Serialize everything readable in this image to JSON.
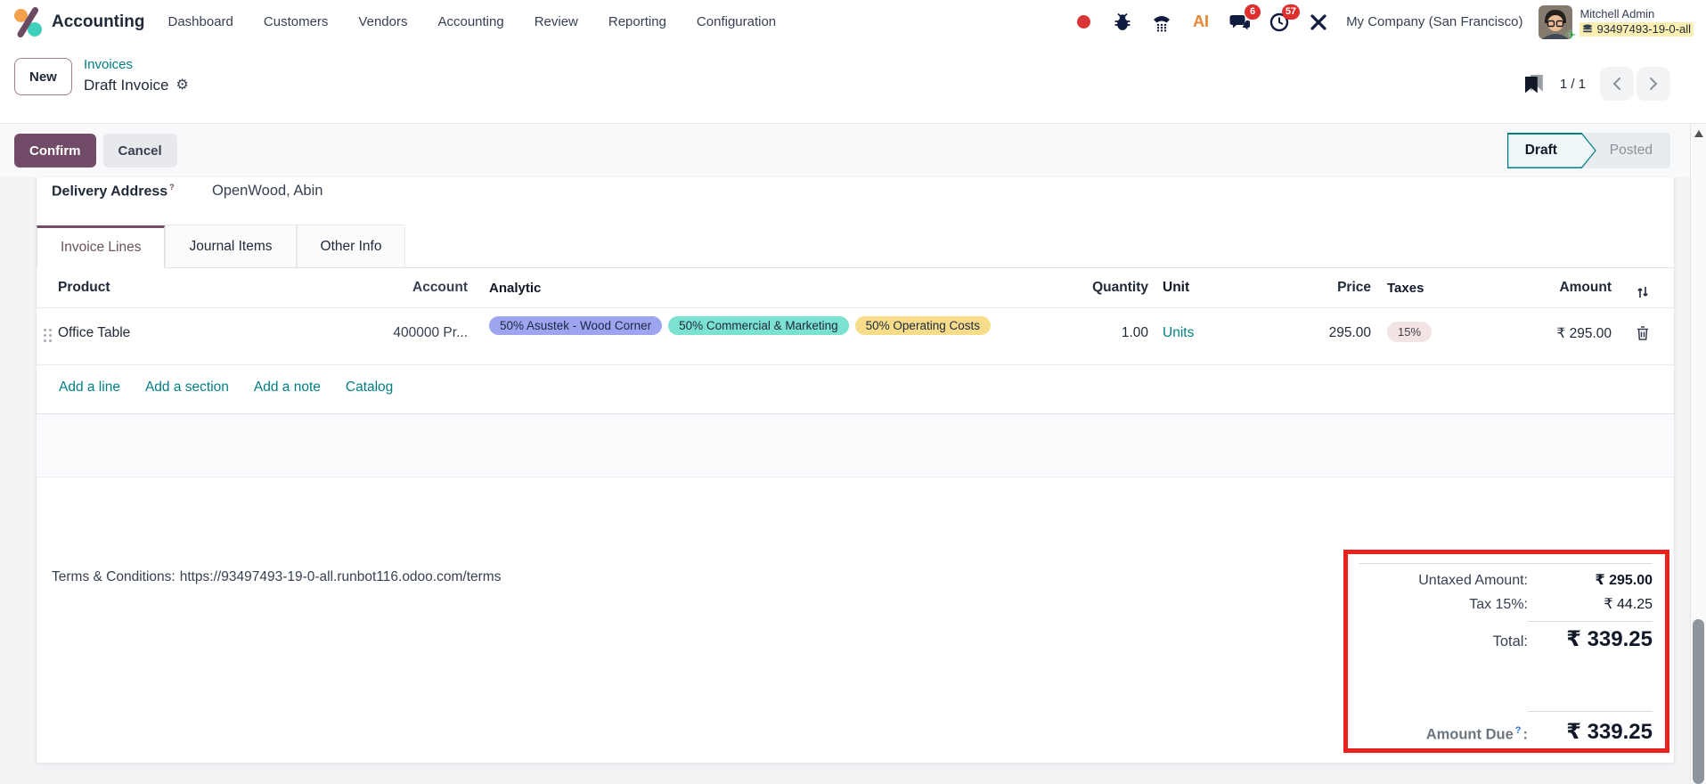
{
  "topnav": {
    "app_name": "Accounting",
    "menu": [
      "Dashboard",
      "Customers",
      "Vendors",
      "Accounting",
      "Review",
      "Reporting",
      "Configuration"
    ],
    "systray": {
      "ai_label": "AI",
      "chat_badge": "6",
      "activity_badge": "57",
      "company": "My Company (San Francisco)",
      "user_name": "Mitchell Admin",
      "database": "93497493-19-0-all"
    }
  },
  "control_panel": {
    "new_button": "New",
    "breadcrumb_parent": "Invoices",
    "breadcrumb_current": "Draft Invoice",
    "pager": "1 / 1"
  },
  "action_bar": {
    "confirm": "Confirm",
    "cancel": "Cancel",
    "status": [
      "Draft",
      "Posted"
    ],
    "active_status": "Draft"
  },
  "form": {
    "delivery_address_label": "Delivery Address",
    "delivery_sup": "?",
    "delivery_address_value": "OpenWood, Abin",
    "tabs": [
      "Invoice Lines",
      "Journal Items",
      "Other Info"
    ],
    "active_tab": "Invoice Lines"
  },
  "lines_table": {
    "headers": [
      "Product",
      "Account",
      "Analytic",
      "Quantity",
      "Unit",
      "Price",
      "Taxes",
      "Amount"
    ],
    "rows": [
      {
        "product": "Office Table",
        "account": "400000 Pr...",
        "analytic_tags": [
          {
            "label": "50% Asustek - Wood Corner",
            "color": "#9da5f0"
          },
          {
            "label": "50% Commercial & Marketing",
            "color": "#7be1d0"
          },
          {
            "label": "50% Operating Costs",
            "color": "#f7dd8a"
          }
        ],
        "quantity": "1.00",
        "unit": "Units",
        "price": "295.00",
        "tax": "15%",
        "amount": "₹ 295.00"
      }
    ],
    "footer_links": [
      "Add a line",
      "Add a section",
      "Add a note",
      "Catalog"
    ]
  },
  "footer": {
    "terms_label": "Terms & Conditions:",
    "terms_url": "https://93497493-19-0-all.runbot116.odoo.com/terms",
    "totals": {
      "untaxed_label": "Untaxed Amount:",
      "untaxed_value": "₹ 295.00",
      "tax_label": "Tax 15%:",
      "tax_value": "₹ 44.25",
      "total_label": "Total:",
      "total_value": "₹ 339.25",
      "amount_due_label": "Amount Due",
      "amount_due_sup": "?",
      "amount_due_colon": ":",
      "amount_due_value": "₹ 339.25"
    }
  },
  "icons": {
    "gear": "⚙",
    "plane": "✈"
  },
  "colors": {
    "primary": "#714B67",
    "link": "#017E84",
    "highlight_annotation": "#e8231d",
    "tag_purple": "#9da5f0",
    "tag_teal": "#7be1d0",
    "tag_yellow": "#f7dd8a",
    "badge_red": "#e02d2d",
    "db_highlight": "#fbeeb2"
  }
}
